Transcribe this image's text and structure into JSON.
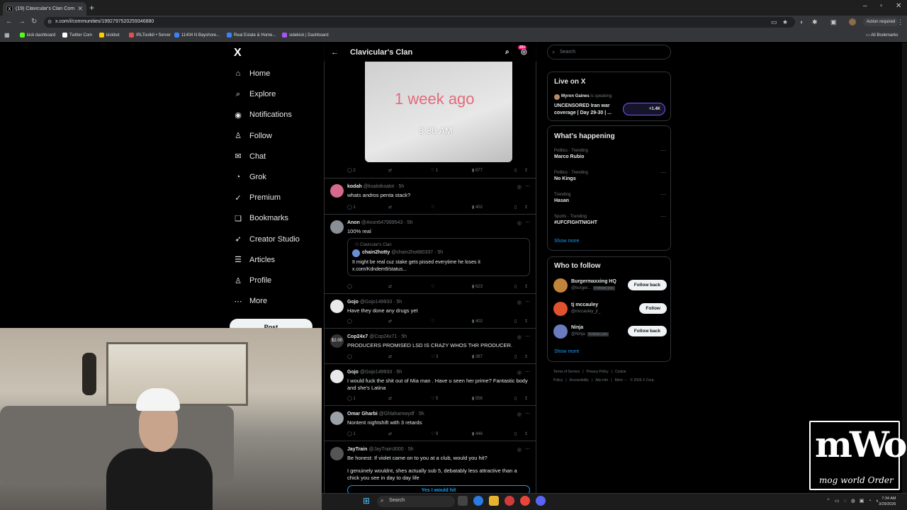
{
  "browser": {
    "tab_title": "(19) Clavicular's Clan Commun",
    "tab_favicon": "X",
    "url": "x.com/i/communities/1992797520259346880",
    "action_required": "Action required",
    "all_bookmarks": "All Bookmarks",
    "bookmarks": [
      {
        "label": "kick dashboard",
        "color": "#53fc18"
      },
      {
        "label": "Twitter Com",
        "color": "#ffffff"
      },
      {
        "label": "kickbot",
        "color": "#ffcc00"
      },
      {
        "label": "IRLToolkit • Server",
        "color": "#e05050"
      },
      {
        "label": "11404 N Bayshore...",
        "color": "#3b82f6"
      },
      {
        "label": "Real Estate & Home...",
        "color": "#3b82f6"
      },
      {
        "label": "sidekick | Dashboard",
        "color": "#a855f7"
      }
    ]
  },
  "nav": {
    "logo": "X",
    "items": [
      {
        "label": "Home",
        "icon": "⌂"
      },
      {
        "label": "Explore",
        "icon": "⌕"
      },
      {
        "label": "Notifications",
        "icon": "◉"
      },
      {
        "label": "Follow",
        "icon": "♙"
      },
      {
        "label": "Chat",
        "icon": "✉"
      },
      {
        "label": "Grok",
        "icon": "◔"
      },
      {
        "label": "Premium",
        "icon": "✓"
      },
      {
        "label": "Bookmarks",
        "icon": "❏"
      },
      {
        "label": "Creator Studio",
        "icon": "➶"
      },
      {
        "label": "Articles",
        "icon": "☰"
      },
      {
        "label": "Profile",
        "icon": "♙"
      },
      {
        "label": "More",
        "icon": "⋯"
      }
    ],
    "post_label": "Post",
    "notif_badge": "",
    "header_badge": "20+"
  },
  "community": {
    "title": "Clavicular's Clan",
    "media_text1": "1 week ago",
    "media_text2": "3:30 AM",
    "first_actions": {
      "replies": "2",
      "likes": "1",
      "views": "677"
    }
  },
  "posts": [
    {
      "name": "kodah",
      "handle": "@ksalotksalot · 5h",
      "text": "whats andros penta stack?",
      "replies": "1",
      "retweets": "",
      "likes": "",
      "views": "402",
      "avatar": "#d46b8a"
    },
    {
      "name": "Anon",
      "handle": "@Anon647999543 · 5h",
      "text": "100% real",
      "replies": "",
      "retweets": "",
      "likes": "",
      "views": "623",
      "avatar": "#8a8f96"
    },
    {
      "name": "Gojo",
      "handle": "@Gojo149933 · 5h",
      "text": "Have they done any drugs yet",
      "replies": "",
      "retweets": "",
      "likes": "",
      "views": "402",
      "avatar": "#e9e9e9"
    },
    {
      "name": "Cop24x7",
      "handle": "@Cop24x71 · 5h",
      "text": "PRODUCERS PROMISED LSD IS CRAZY WHOS THR PRODUCER.",
      "replies": "",
      "retweets": "",
      "likes": "3",
      "views": "387",
      "avatar": "#333"
    },
    {
      "name": "Gojo",
      "handle": "@Gojo149933 · 5h",
      "text": "I would fuck the shit out of Mia man . Have u seen her prime? Fantastic body and she's Latina",
      "replies": "1",
      "retweets": "",
      "likes": "5",
      "views": "556",
      "avatar": "#e9e9e9"
    },
    {
      "name": "Omar Gharbi",
      "handle": "@Ghlahamwydf · 5h",
      "text": "Nontent nightshift with 3 retards",
      "replies": "1",
      "retweets": "",
      "likes": "9",
      "views": "446",
      "avatar": "#9aa0a6"
    },
    {
      "name": "JayTrain",
      "handle": "@JayTrain3000 · 5h",
      "text": "Be honest: If violet came on to you at a club, would you hit?",
      "text2": "I genuinely wouldnt, shes actually sub 5, debatably less attractive than a chick you see in day to day life",
      "avatar": "#555"
    }
  ],
  "cop_avatar_text": "$2.00",
  "quote": {
    "community": "Clavicular's Clan",
    "name": "chain2hotty",
    "handle": "@chain2hott80337 · 5h",
    "text": "It might be real cuz stake gets pissed everytime he loses it x.com/Kdndem9/status..."
  },
  "poll_option": "Yes I would hit",
  "right": {
    "search_placeholder": "Search",
    "live_title": "Live on X",
    "live_host": "Myron Gaines",
    "live_status": "is speaking",
    "live_text": "UNCENSORED Iran war coverage | Day 29-30 | ...",
    "live_count": "+1.4K",
    "happening_title": "What's happening",
    "trends": [
      {
        "cat": "Politics · Trending",
        "name": "Marco Rubio"
      },
      {
        "cat": "Politics · Trending",
        "name": "No Kings"
      },
      {
        "cat": "Trending",
        "name": "Hasan"
      },
      {
        "cat": "Sports · Trending",
        "name": "#UFCFIGHTNIGHT"
      }
    ],
    "show_more": "Show more",
    "wtf_title": "Who to follow",
    "wtf": [
      {
        "name": "Burgermaxxing HQ",
        "handle": "@burger...",
        "follows": "Follows you",
        "btn": "Follow back",
        "color": "#c0853a"
      },
      {
        "name": "tj mccauley",
        "handle": "@mccauley_jr_",
        "follows": "",
        "btn": "Follow",
        "color": "#e0532e"
      },
      {
        "name": "Ninja",
        "handle": "@Ninja",
        "follows": "Follows you",
        "btn": "Follow back",
        "color": "#6a7cbf"
      }
    ],
    "footer": [
      "Terms of Service",
      "|",
      "Privacy Policy",
      "|",
      "Cookie Policy",
      "|",
      "Accessibility",
      "|",
      "Ads info",
      "|",
      "More ···",
      "© 2026 X Corp."
    ]
  },
  "taskbar": {
    "search": "Search",
    "time": "7:34 AM",
    "date": "3/29/2026"
  },
  "overlay": {
    "logo_big": "mWo",
    "logo_small": "mog world Order"
  }
}
